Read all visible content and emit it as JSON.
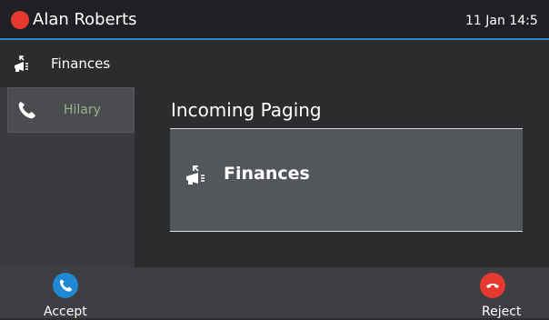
{
  "status_bar": {
    "user_name": "Alan Roberts",
    "datetime": "11 Jan 14:5",
    "status_color": "#e53930",
    "accent_line_color": "#2f86c8"
  },
  "paging_bar": {
    "icon": "megaphone-icon",
    "label": "Finances"
  },
  "sidebar": {
    "line": {
      "icon": "phone-icon",
      "label": "Hilary"
    }
  },
  "main": {
    "title": "Incoming Paging",
    "card": {
      "icon": "megaphone-icon",
      "label": "Finances"
    }
  },
  "softkeys": {
    "accept": {
      "label": "Accept",
      "icon": "phone-icon",
      "color": "#1e88d2"
    },
    "reject": {
      "label": "Reject",
      "icon": "hang-up-icon",
      "color": "#e53930"
    }
  }
}
